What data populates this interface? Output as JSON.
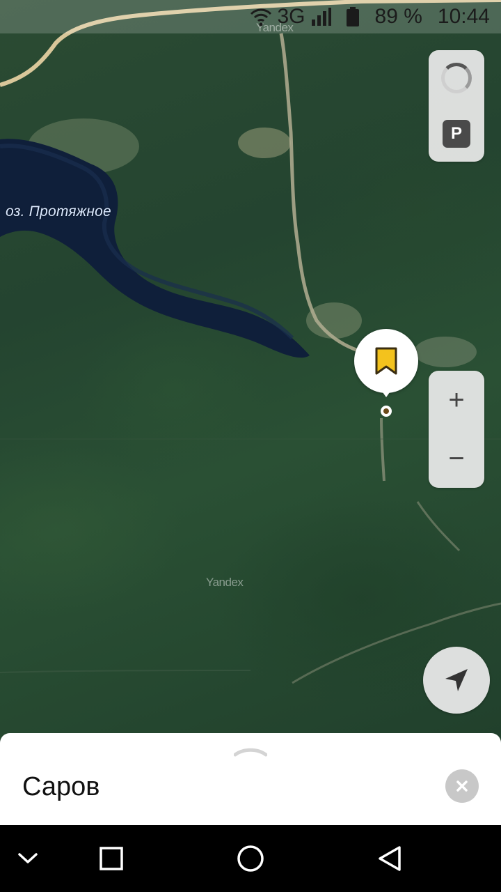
{
  "status_bar": {
    "network": "3G",
    "battery_percent": "89 %",
    "time": "10:44",
    "icons": [
      "wifi-icon",
      "cell-signal-icon",
      "battery-icon"
    ]
  },
  "map": {
    "lake_label": "оз. Протяжное",
    "watermarks": [
      "Yandex",
      "Yandex"
    ]
  },
  "controls": {
    "traffic_icon": "traffic-icon",
    "parking_label": "P",
    "zoom_in_label": "+",
    "zoom_out_label": "−",
    "locate_icon": "navigation-arrow-icon"
  },
  "marker": {
    "icon": "bookmark-icon",
    "color": "#f3c21d"
  },
  "bottom_sheet": {
    "title": "Саров",
    "handle_icon": "chevron-up-icon",
    "close_icon": "close-icon"
  },
  "nav_bar": {
    "buttons": [
      "chevron-down-icon",
      "recents-square-icon",
      "home-circle-icon",
      "back-triangle-icon"
    ]
  }
}
